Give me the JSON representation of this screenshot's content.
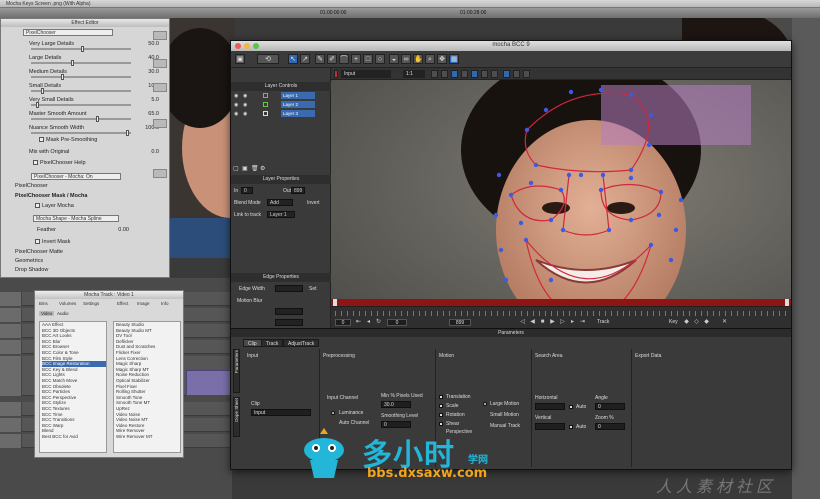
{
  "host": {
    "menubar_title": "Mocha Keys Screen .png (With Alpha)",
    "timecode_left": "01:00:00:00",
    "timecode_right": "01:00:28:00"
  },
  "effect_editor": {
    "title": "Effect Editor",
    "tab": "PixelChooser",
    "rows": [
      {
        "label": "Very Large Details",
        "value": "50.0"
      },
      {
        "label": "Large Details",
        "value": "40.0"
      },
      {
        "label": "Medium Details",
        "value": "30.0"
      },
      {
        "label": "Small Details",
        "value": "10.0"
      },
      {
        "label": "Very Small Details",
        "value": "5.0"
      },
      {
        "label": "Master Smooth Amount",
        "value": "65.0"
      },
      {
        "label": "Nuance Smooth Width",
        "value": "100.0"
      }
    ],
    "check_mask_pre_smoothing": "Mask Pre-Smoothing",
    "mix_with_original": {
      "label": "Mix with Original",
      "value": "0.0"
    },
    "pixelchooser_help": "PixelChooser Help",
    "pixelchooser_dropdown": "PixelChooser - Mocha: On",
    "sections": [
      "PixelChooser",
      "PixelChooser Mask / Mocha"
    ],
    "layer_mocha": "Layer Mocha",
    "mocha_shape_dropdown": "Mocha Shape - Mocha Spline",
    "feather": {
      "label": "Feather",
      "value": "0.00"
    },
    "invert_mask": "Invert Mask",
    "tail_sections": [
      "PixelChooser Matte",
      "Geometrics",
      "Drop Shadow"
    ]
  },
  "mocha_track": {
    "title": "Mocha Track : Video 1",
    "menus": [
      "Bins",
      "Volumes",
      "Settings",
      "Effect",
      "Image",
      "Info"
    ],
    "tabs": [
      "Video",
      "Audio"
    ],
    "left_list": [
      "AAA Effect",
      "BCC 3D Objects",
      "BCC Art Looks",
      "BCC Blur",
      "BCC Browser",
      "BCC Color & Tone",
      "BCC Film Style",
      "BCC Image Restoration",
      "BCC Key & Blend",
      "BCC Lights",
      "BCC Match Move",
      "BCC Obsolete",
      "BCC Particles",
      "BCC Perspective",
      "BCC Stylize",
      "BCC Textures",
      "BCC Time",
      "BCC Transitions",
      "BCC Warp",
      "Blend",
      "Best BCC for Avid"
    ],
    "right_list": [
      "Beauty Studio",
      "Beauty Studio MT",
      "DV Tool",
      "Deflicker",
      "Dust and Scratches",
      "Flicker Fixer",
      "Lens Correction",
      "Magic Sharp",
      "Magic Sharp MT",
      "Noise Reduction",
      "Optical Stabilizer",
      "Pixel Fixer",
      "Rolling Shutter",
      "Smooth Tone",
      "Smooth Tone MT",
      "UpRez",
      "Video Noise",
      "Video Noise MT",
      "Video Restore",
      "Wire Remover",
      "Wire Remover MT"
    ]
  },
  "mocha": {
    "title": "mocha BCC 9",
    "layer_controls_header": "Layer Controls",
    "layers": [
      "Layer 1",
      "Layer 2",
      "Layer 3"
    ],
    "input_dropdown": "Input",
    "zoom_dropdown": "1:1",
    "layer_properties_header": "Layer Properties",
    "in_label": "In",
    "in_value": "0",
    "out_label": "Out",
    "out_value": "899",
    "blend_mode_label": "Blend Mode",
    "blend_mode_value": "Add",
    "invert_label": "Invert",
    "link_to_track_label": "Link to track",
    "link_to_track_value": "Layer 1",
    "edge_properties_header": "Edge Properties",
    "edge_width_label": "Edge Width",
    "set_label": "Set",
    "motion_blur_label": "Motion Blur",
    "transport": {
      "start_field": "0",
      "current_field": "0",
      "end_field": "899",
      "track_label": "Track",
      "key_label": "Key"
    },
    "params": {
      "header": "Parameters",
      "tabs": [
        "Clip",
        "Track",
        "AdjustTrack"
      ],
      "vtabs": [
        "Parameters",
        "Dope Sheet"
      ],
      "sections": {
        "input": "Input",
        "preprocessing": "Preprocessing",
        "motion": "Motion",
        "search_area": "Search Area",
        "export_data": "Export Data"
      },
      "clip_label": "Clip",
      "clip_value": "Input",
      "input_channel_label": "Input Channel",
      "luminance": "Luminance",
      "auto_channel": "Auto Channel",
      "min_pixels_label": "Min % Pixels Used",
      "min_pixels_value": "30.0",
      "smoothing_label": "Smoothing Level",
      "smoothing_value": "0",
      "motion_translation": "Translation",
      "motion_scale": "Scale",
      "motion_rotation": "Rotation",
      "motion_shear": "Shear",
      "motion_perspective": "Perspective",
      "large_motion": "Large Motion",
      "small_motion": "Small Motion",
      "manual_track": "Manual Track",
      "horizontal_label": "Horizontal",
      "vertical_label": "Vertical",
      "auto_label": "Auto",
      "angle_label": "Angle",
      "zoom_label": "Zoom %",
      "angle_value": "0",
      "zoom_value": "0"
    }
  },
  "watermark": {
    "cn_title": "多小时",
    "cn_small": "学网",
    "url": "bbs.dxsaxw.com",
    "corner": "人人素材社区"
  },
  "colors": {
    "timeline_red": "#8f1515",
    "spline_red": "#d2283c",
    "spline_points": "#3c5ae6",
    "accent_blue": "#2f69b3",
    "watermark_blue": "#23b6d8",
    "watermark_orange": "#f0a51c"
  }
}
